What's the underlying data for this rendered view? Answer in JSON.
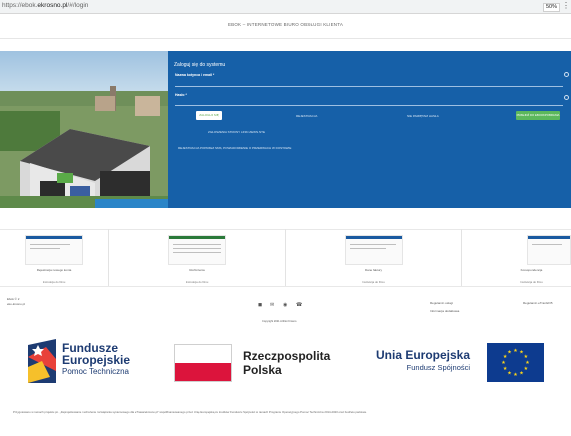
{
  "browser": {
    "url_prefix": "https://ebok.",
    "url_domain": "ekrosno.pl",
    "url_suffix": "/#/login",
    "zoom": "50%",
    "menu_icon": "more-vertical-icon"
  },
  "header": {
    "title": "EBOK – INTERNETOWE BIURO OBSŁUGI KLIENTA"
  },
  "login": {
    "heading": "Zaloguj się do systemu",
    "user_label": "Nazwa kotynca / email *",
    "password_label": "Hasło *",
    "login_button": "ZALOGUJ SIĘ",
    "register_link": "REJESTRACJA",
    "forgot_link": "NIE PAMIĘTAM HASŁA",
    "guest_button": "PRZEJDŹ DO EBOOKPOBRANIA",
    "portal_link": "ZGŁOSZENIA STRONY LINKI ZEWN.NTE",
    "procedure_link": "REJESTRACJA POPRZEZ SMS, POWIADOMIENIE O PRZERWACH W DOSTAWIE",
    "accent": "#1660a8",
    "green": "#5cb85c"
  },
  "cards": [
    {
      "caption": "Rejestracja nowego konta",
      "sub": "Instrukcja do filmu"
    },
    {
      "caption": "Rozliczenia",
      "sub": "Instrukcja do filmu"
    },
    {
      "caption": "Dane faktury",
      "sub": "Instrukcja do filmu"
    },
    {
      "caption": "Korespondencja",
      "sub": "Instrukcja do filmu"
    }
  ],
  "footer": {
    "left_line1": "Ebok © 2",
    "left_line2": "eko-krosno.pl",
    "icons": [
      "facebook-icon",
      "email-icon",
      "location-icon",
      "phone-icon"
    ],
    "copyright": "Copyright 2021 ArtNet Krosno",
    "col1_line1": "Regulamin usługi",
    "col1_line2": "Informacja dodatkowa",
    "col2_line1": "Regulamin eTranGFI5"
  },
  "logos": {
    "fe_line1": "Fundusze",
    "fe_line2": "Europejskie",
    "fe_line3": "Pomoc Techniczna",
    "rp_line1": "Rzeczpospolita",
    "rp_line2": "Polska",
    "ue_line1": "Unia Europejska",
    "ue_line2": "Fundusz Spójności"
  },
  "disclaimer": "Przygotowano w ramach projektu pn. „Zaprojektowanie i wdrożenie rozwiązania systemowego dla eTrawa/ekrosno.pl” współfinansowanego przez Unię Europejską ze środków Funduszu Spójności w ramach Programu Operacyjnego Pomoc Techniczna 2014-2020 oraz budżetu państwa."
}
